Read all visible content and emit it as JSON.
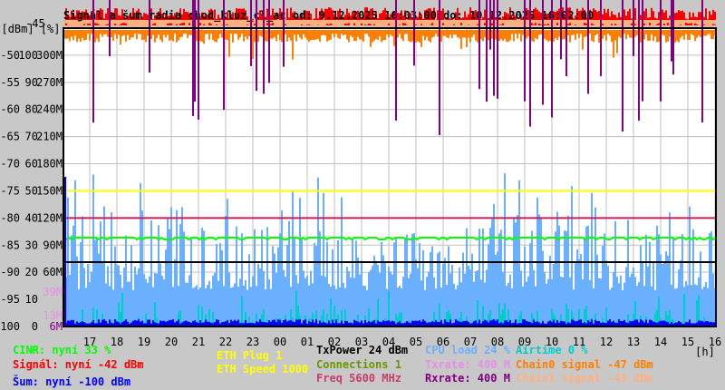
{
  "chart_data": {
    "type": "line",
    "title": "Signál a šum radia chod_kluz_cl_ac od: 9.12.2025 16:03:00 do: 10.12.2025 16:02:00",
    "ylabel": "[dBm] [%]",
    "xlabel": "[h]",
    "y_top_label": "-45",
    "ylim": [
      -100,
      -45
    ],
    "y_ticks": [
      {
        "dbm": "-50",
        "pct": "100",
        "rate": "300M"
      },
      {
        "dbm": "-55",
        "pct": "90",
        "rate": "270M"
      },
      {
        "dbm": "-60",
        "pct": "80",
        "rate": "240M"
      },
      {
        "dbm": "-65",
        "pct": "70",
        "rate": "210M"
      },
      {
        "dbm": "-70",
        "pct": "60",
        "rate": "180M"
      },
      {
        "dbm": "-75",
        "pct": "50",
        "rate": "150M"
      },
      {
        "dbm": "-80",
        "pct": "40",
        "rate": "120M"
      },
      {
        "dbm": "-85",
        "pct": "30",
        "rate": "90M"
      },
      {
        "dbm": "-90",
        "pct": "20",
        "rate": "60M"
      },
      {
        "dbm": "-95",
        "pct": "10",
        "rate": ""
      },
      {
        "dbm": "-100",
        "pct": "0",
        "rate": "6M"
      }
    ],
    "extra_rate_labels": [
      "39M",
      "13M"
    ],
    "x_ticks": [
      "17",
      "18",
      "19",
      "20",
      "21",
      "22",
      "23",
      "00",
      "01",
      "02",
      "03",
      "04",
      "05",
      "06",
      "07",
      "08",
      "09",
      "10",
      "11",
      "12",
      "13",
      "14",
      "15",
      "16"
    ],
    "grid": true,
    "series": [
      {
        "name": "CINR",
        "color": "#00ff00",
        "current": 33,
        "unit": "%"
      },
      {
        "name": "Signál",
        "color": "#ff0000",
        "current": -42,
        "unit": "dBm"
      },
      {
        "name": "Šum",
        "color": "#0000ff",
        "current": -100,
        "unit": "dBm"
      },
      {
        "name": "ETH Plug",
        "color": "#ffff00",
        "current": 1
      },
      {
        "name": "ETH Speed",
        "color": "#c81e5a",
        "current": 1000
      },
      {
        "name": "TxPower",
        "color": "#000000",
        "current": 24,
        "unit": "dBm"
      },
      {
        "name": "Connections",
        "color": "#669900",
        "current": 1
      },
      {
        "name": "Freq",
        "color": "#c83c6e",
        "current": 5600,
        "unit": "MHz"
      },
      {
        "name": "CPU load",
        "color": "#6ab0ff",
        "current": 24,
        "unit": "%"
      },
      {
        "name": "Txrate",
        "color": "#e88ee8",
        "current": 400,
        "unit": "M"
      },
      {
        "name": "Rxrate",
        "color": "#800080",
        "current": 400,
        "unit": "M"
      },
      {
        "name": "Airtime",
        "color": "#00cccc",
        "current": 0,
        "unit": "%"
      },
      {
        "name": "Chain0 signal",
        "color": "#ff8000",
        "current": -47,
        "unit": "dBm"
      },
      {
        "name": "Chain1 signal",
        "color": "#ffb080",
        "current": -43,
        "unit": "dBm"
      }
    ]
  },
  "legend": {
    "cinr": "CINR: nyní 33 %",
    "signal": "Signál: nyní -42 dBm",
    "noise": "Šum: nyní -100 dBm",
    "eth_plug": "ETH Plug 1",
    "eth_speed": "ETH Speed 1000",
    "txpower": "TxPower 24 dBm",
    "connections": "Connections 1",
    "freq": "Freq 5600 MHz",
    "cpu": "CPU load 24 %",
    "txrate": "Txrate: 400 M",
    "rxrate": "Rxrate: 400 M",
    "airtime": "Airtime 0 %",
    "chain0": "Chain0 signal -47 dBm",
    "chain1": "Chain1 signal -43 dBm"
  }
}
